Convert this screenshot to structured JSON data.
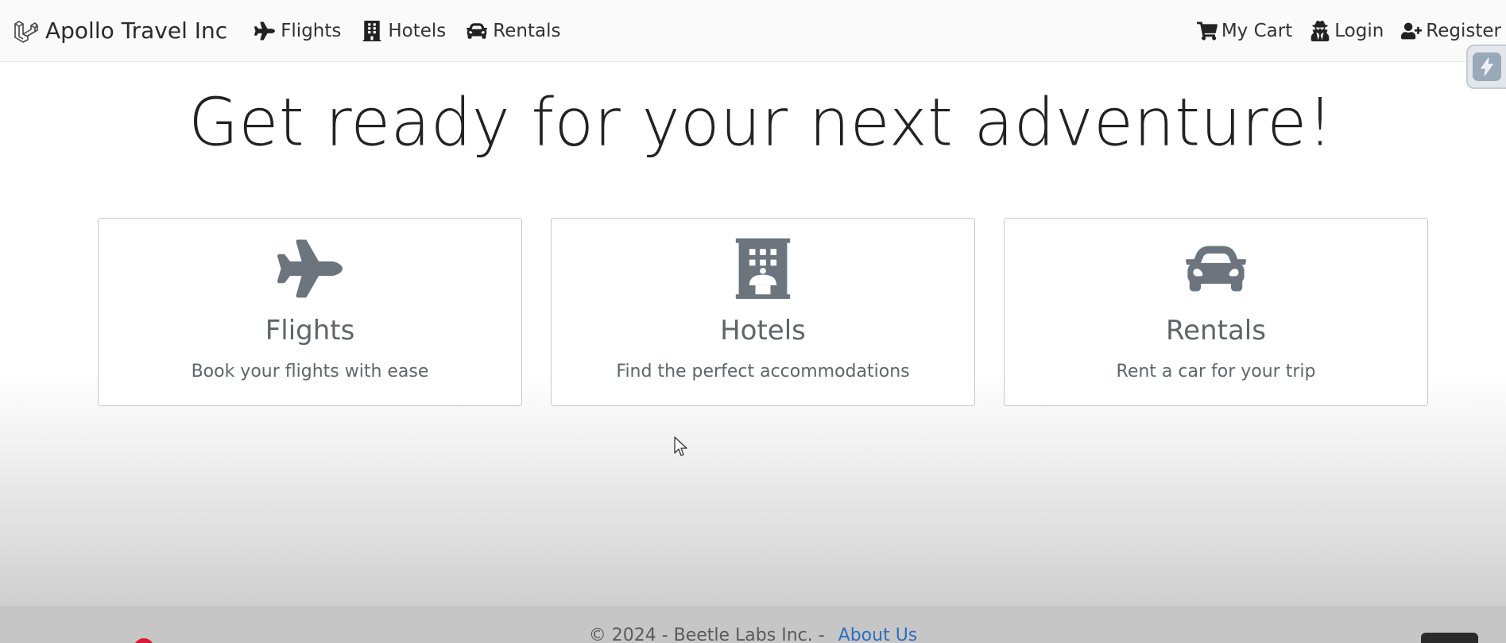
{
  "navbar": {
    "brand": "Apollo Travel Inc",
    "brand_icon": "laravel-logo-icon",
    "left_links": [
      {
        "label": "Flights",
        "icon": "plane-icon"
      },
      {
        "label": "Hotels",
        "icon": "building-icon"
      },
      {
        "label": "Rentals",
        "icon": "car-icon"
      }
    ],
    "right_links": [
      {
        "label": "My Cart",
        "icon": "cart-icon"
      },
      {
        "label": "Login",
        "icon": "user-secret-icon"
      },
      {
        "label": "Register",
        "icon": "user-plus-icon"
      }
    ]
  },
  "hero": {
    "title": "Get ready for your next adventure!"
  },
  "cards": [
    {
      "title": "Flights",
      "text": "Book your flights with ease",
      "icon": "plane-icon"
    },
    {
      "title": "Hotels",
      "text": "Find the perfect accommodations",
      "icon": "hotel-icon"
    },
    {
      "title": "Rentals",
      "text": "Rent a car for your trip",
      "icon": "car-icon"
    }
  ],
  "footer": {
    "text": "© 2024 - Beetle Labs Inc. -",
    "link": "About Us"
  },
  "colors": {
    "card_icon": "#6c757d",
    "link": "#2d6fc0",
    "text_muted": "#5f6669"
  }
}
